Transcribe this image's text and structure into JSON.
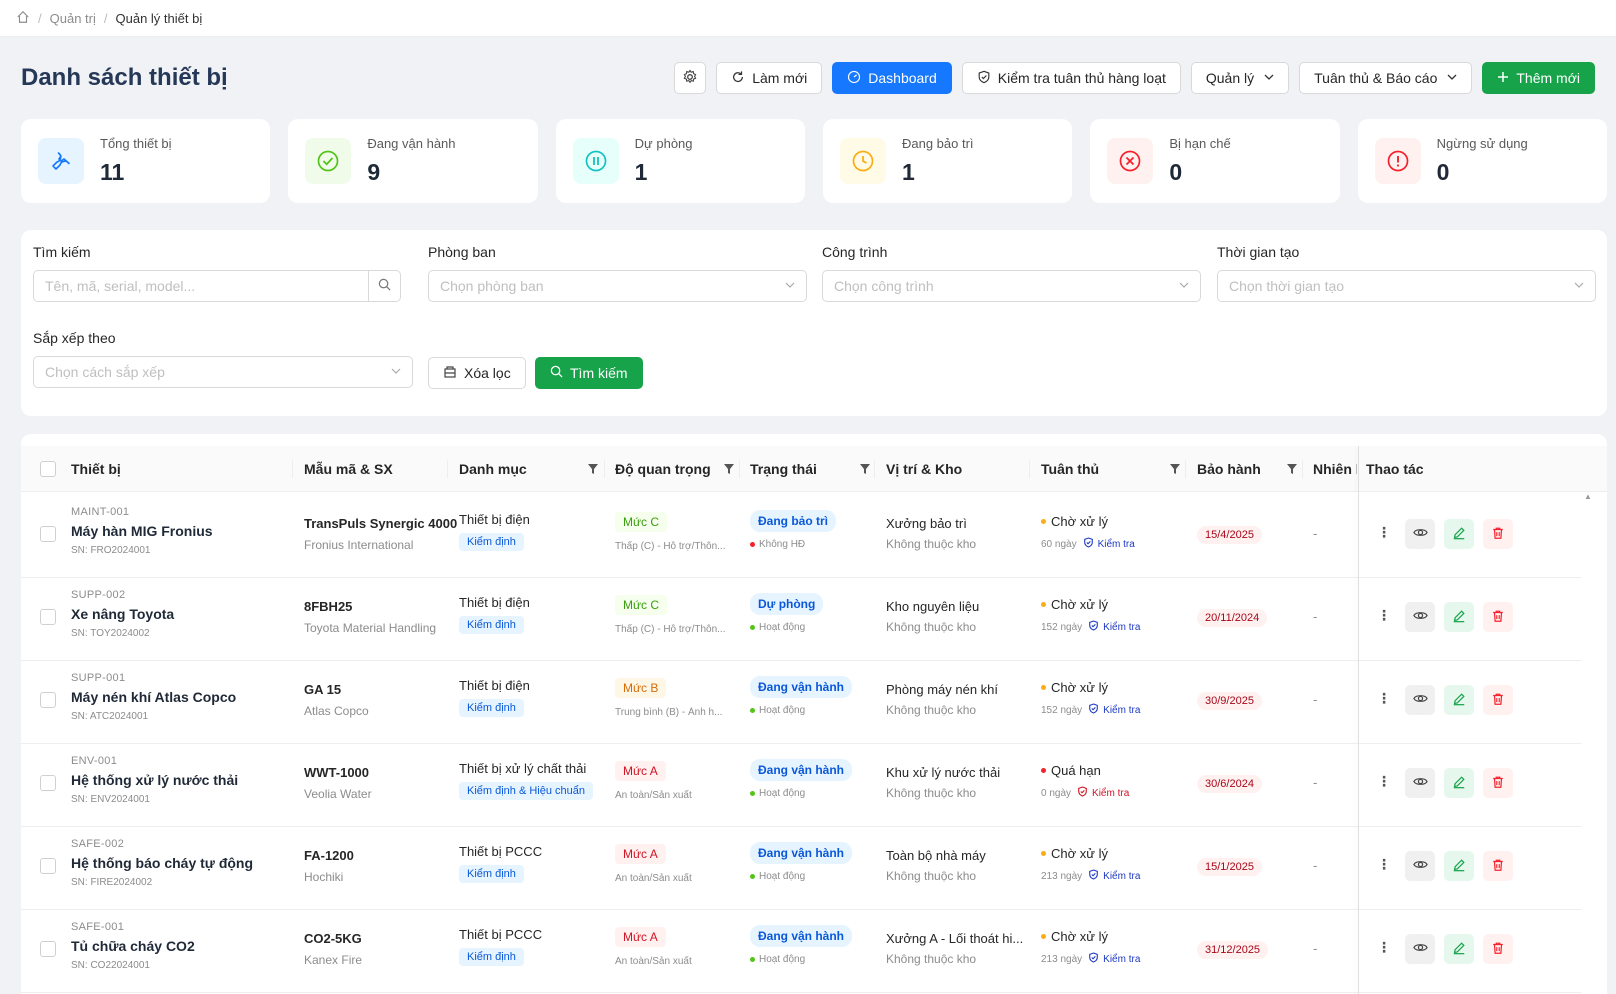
{
  "breadcrumb": {
    "items": [
      "Quản trị",
      "Quản lý thiết bị"
    ]
  },
  "header": {
    "title": "Danh sách thiết bị",
    "buttons": {
      "refresh": "Làm mới",
      "dashboard": "Dashboard",
      "bulk_check": "Kiểm tra tuân thủ hàng loạt",
      "manage": "Quản lý",
      "compliance": "Tuân thủ & Báo cáo",
      "add": "Thêm mới"
    }
  },
  "stats": [
    {
      "label": "Tổng thiết bị",
      "value": "11",
      "icon": "wrench-icon",
      "color": "#1677ff",
      "bg": "#e6f4ff"
    },
    {
      "label": "Đang vận hành",
      "value": "9",
      "icon": "check-circle-icon",
      "color": "#52c41a",
      "bg": "#f0fbea"
    },
    {
      "label": "Dự phòng",
      "value": "1",
      "icon": "pause-circle-icon",
      "color": "#13c2c2",
      "bg": "#e6fffb"
    },
    {
      "label": "Đang bảo trì",
      "value": "1",
      "icon": "clock-icon",
      "color": "#faad14",
      "bg": "#fffbe6"
    },
    {
      "label": "Bị hạn chế",
      "value": "0",
      "icon": "close-circle-icon",
      "color": "#f5222d",
      "bg": "#fff1f0"
    },
    {
      "label": "Ngừng sử dụng",
      "value": "0",
      "icon": "exclamation-circle-icon",
      "color": "#f5222d",
      "bg": "#fff1f0"
    }
  ],
  "filters": {
    "search": {
      "label": "Tìm kiếm",
      "placeholder": "Tên, mã, serial, model..."
    },
    "department": {
      "label": "Phòng ban",
      "placeholder": "Chọn phòng ban"
    },
    "project": {
      "label": "Công trình",
      "placeholder": "Chọn công trình"
    },
    "created": {
      "label": "Thời gian tạo",
      "placeholder": "Chọn thời gian tạo"
    },
    "sort": {
      "label": "Sắp xếp theo",
      "placeholder": "Chọn cách sắp xếp"
    },
    "clear_label": "Xóa lọc",
    "search_label": "Tìm kiếm"
  },
  "table": {
    "columns": [
      "Thiết bị",
      "Mẫu mã & SX",
      "Danh mục",
      "Độ quan trọng",
      "Trạng thái",
      "Vị trí & Kho",
      "Tuân thủ",
      "Bảo hành",
      "Nhiên l",
      "Thao tác"
    ],
    "rows": [
      {
        "code": "MAINT-001",
        "name": "Máy hàn MIG Fronius",
        "serial": "SN: FRO2024001",
        "model": "TransPuls Synergic 4000",
        "maker": "Fronius International",
        "category": "Thiết bị điện",
        "tag": "Kiểm định",
        "level": "Mức C",
        "level_class": "c",
        "level_desc": "Thấp (C) - Hỗ trợ/Thôn...",
        "status": "Đang bảo trì",
        "substatus": "Không HĐ",
        "sub_dot": "#f5222d",
        "location": "Xưởng bảo trì",
        "warehouse": "Không thuộc kho",
        "compliance": "Chờ xử lý",
        "comp_dot": "#faad14",
        "days": "60 ngày",
        "check": "Kiểm tra",
        "check_red": false,
        "warranty": "15/4/2025",
        "fuel": "-"
      },
      {
        "code": "SUPP-002",
        "name": "Xe nâng Toyota",
        "serial": "SN: TOY2024002",
        "model": "8FBH25",
        "maker": "Toyota Material Handling",
        "category": "Thiết bị điện",
        "tag": "Kiểm định",
        "level": "Mức C",
        "level_class": "c",
        "level_desc": "Thấp (C) - Hỗ trợ/Thôn...",
        "status": "Dự phòng",
        "substatus": "Hoạt động",
        "sub_dot": "#52c41a",
        "location": "Kho nguyên liệu",
        "warehouse": "Không thuộc kho",
        "compliance": "Chờ xử lý",
        "comp_dot": "#faad14",
        "days": "152 ngày",
        "check": "Kiểm tra",
        "check_red": false,
        "warranty": "20/11/2024",
        "fuel": "-"
      },
      {
        "code": "SUPP-001",
        "name": "Máy nén khí Atlas Copco",
        "serial": "SN: ATC2024001",
        "model": "GA 15",
        "maker": "Atlas Copco",
        "category": "Thiết bị điện",
        "tag": "Kiểm định",
        "level": "Mức B",
        "level_class": "b",
        "level_desc": "Trung bình (B) - Ảnh h...",
        "status": "Đang vận hành",
        "substatus": "Hoạt động",
        "sub_dot": "#52c41a",
        "location": "Phòng máy nén khí",
        "warehouse": "Không thuộc kho",
        "compliance": "Chờ xử lý",
        "comp_dot": "#faad14",
        "days": "152 ngày",
        "check": "Kiểm tra",
        "check_red": false,
        "warranty": "30/9/2025",
        "fuel": "-"
      },
      {
        "code": "ENV-001",
        "name": "Hệ thống xử lý nước thải",
        "serial": "SN: ENV2024001",
        "model": "WWT-1000",
        "maker": "Veolia Water",
        "category": "Thiết bị xử lý chất thải",
        "tag": "Kiểm định & Hiệu chuẩn",
        "level": "Mức A",
        "level_class": "a",
        "level_desc": "An toàn/Sản xuất",
        "status": "Đang vận hành",
        "substatus": "Hoạt động",
        "sub_dot": "#52c41a",
        "location": "Khu xử lý nước thải",
        "warehouse": "Không thuộc kho",
        "compliance": "Quá hạn",
        "comp_dot": "#f5222d",
        "days": "0 ngày",
        "check": "Kiểm tra",
        "check_red": true,
        "warranty": "30/6/2024",
        "fuel": "-"
      },
      {
        "code": "SAFE-002",
        "name": "Hệ thống báo cháy tự động",
        "serial": "SN: FIRE2024002",
        "model": "FA-1200",
        "maker": "Hochiki",
        "category": "Thiết bị PCCC",
        "tag": "Kiểm định",
        "level": "Mức A",
        "level_class": "a",
        "level_desc": "An toàn/Sản xuất",
        "status": "Đang vận hành",
        "substatus": "Hoạt động",
        "sub_dot": "#52c41a",
        "location": "Toàn bộ nhà máy",
        "warehouse": "Không thuộc kho",
        "compliance": "Chờ xử lý",
        "comp_dot": "#faad14",
        "days": "213 ngày",
        "check": "Kiểm tra",
        "check_red": false,
        "warranty": "15/1/2025",
        "fuel": "-"
      },
      {
        "code": "SAFE-001",
        "name": "Tủ chữa cháy CO2",
        "serial": "SN: CO22024001",
        "model": "CO2-5KG",
        "maker": "Kanex Fire",
        "category": "Thiết bị PCCC",
        "tag": "Kiểm định",
        "level": "Mức A",
        "level_class": "a",
        "level_desc": "An toàn/Sản xuất",
        "status": "Đang vận hành",
        "substatus": "Hoạt động",
        "sub_dot": "#52c41a",
        "location": "Xưởng A - Lối thoát hi...",
        "warehouse": "Không thuộc kho",
        "compliance": "Chờ xử lý",
        "comp_dot": "#faad14",
        "days": "213 ngày",
        "check": "Kiểm tra",
        "check_red": false,
        "warranty": "31/12/2025",
        "fuel": "-"
      }
    ]
  }
}
